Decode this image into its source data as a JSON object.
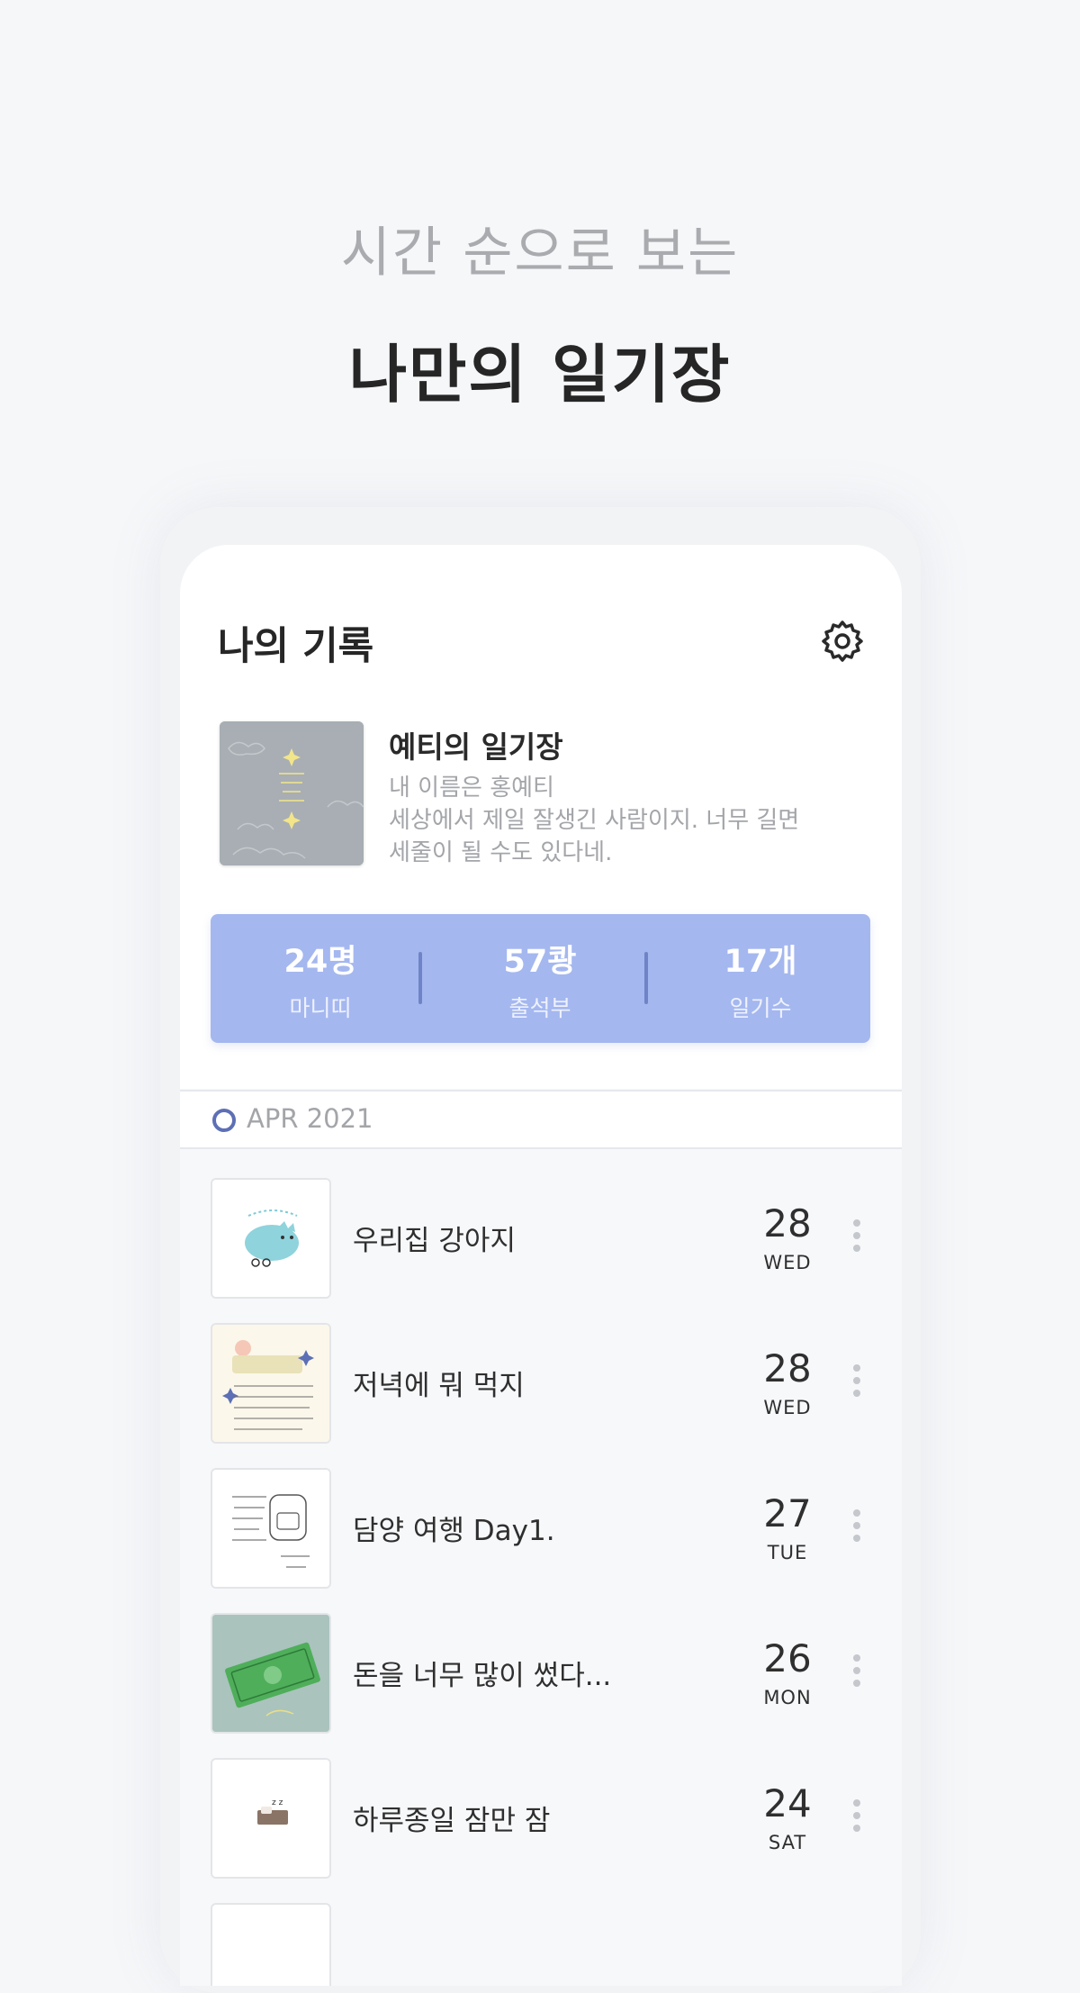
{
  "hero": {
    "subtitle": "시간 순으로 보는",
    "title": "나만의 일기장"
  },
  "screen": {
    "title": "나의 기록",
    "settings_icon": "gear-icon"
  },
  "profile": {
    "diary_name": "예티의 일기장",
    "description_lines": [
      "내 이름은 홍예티",
      "세상에서 제일 잘생긴 사람이지. 너무 길면",
      "세줄이 될 수도 있다네."
    ]
  },
  "stats": [
    {
      "value": "24명",
      "label": "마니띠"
    },
    {
      "value": "57쾅",
      "label": "출석부"
    },
    {
      "value": "17개",
      "label": "일기수"
    }
  ],
  "month": "APR 2021",
  "entries": [
    {
      "title": "우리집 강아지",
      "day": "28",
      "dow": "WED"
    },
    {
      "title": "저녁에 뭐 먹지",
      "day": "28",
      "dow": "WED"
    },
    {
      "title": "담양 여행 Day1.",
      "day": "27",
      "dow": "TUE"
    },
    {
      "title": "돈을 너무 많이 썼다...",
      "day": "26",
      "dow": "MON"
    },
    {
      "title": "하루종일 잠만 잠",
      "day": "24",
      "dow": "SAT"
    }
  ],
  "colors": {
    "stats_bg": "#a4b7ef",
    "accent": "#5d6fb5",
    "background": "#f6f7f9"
  }
}
